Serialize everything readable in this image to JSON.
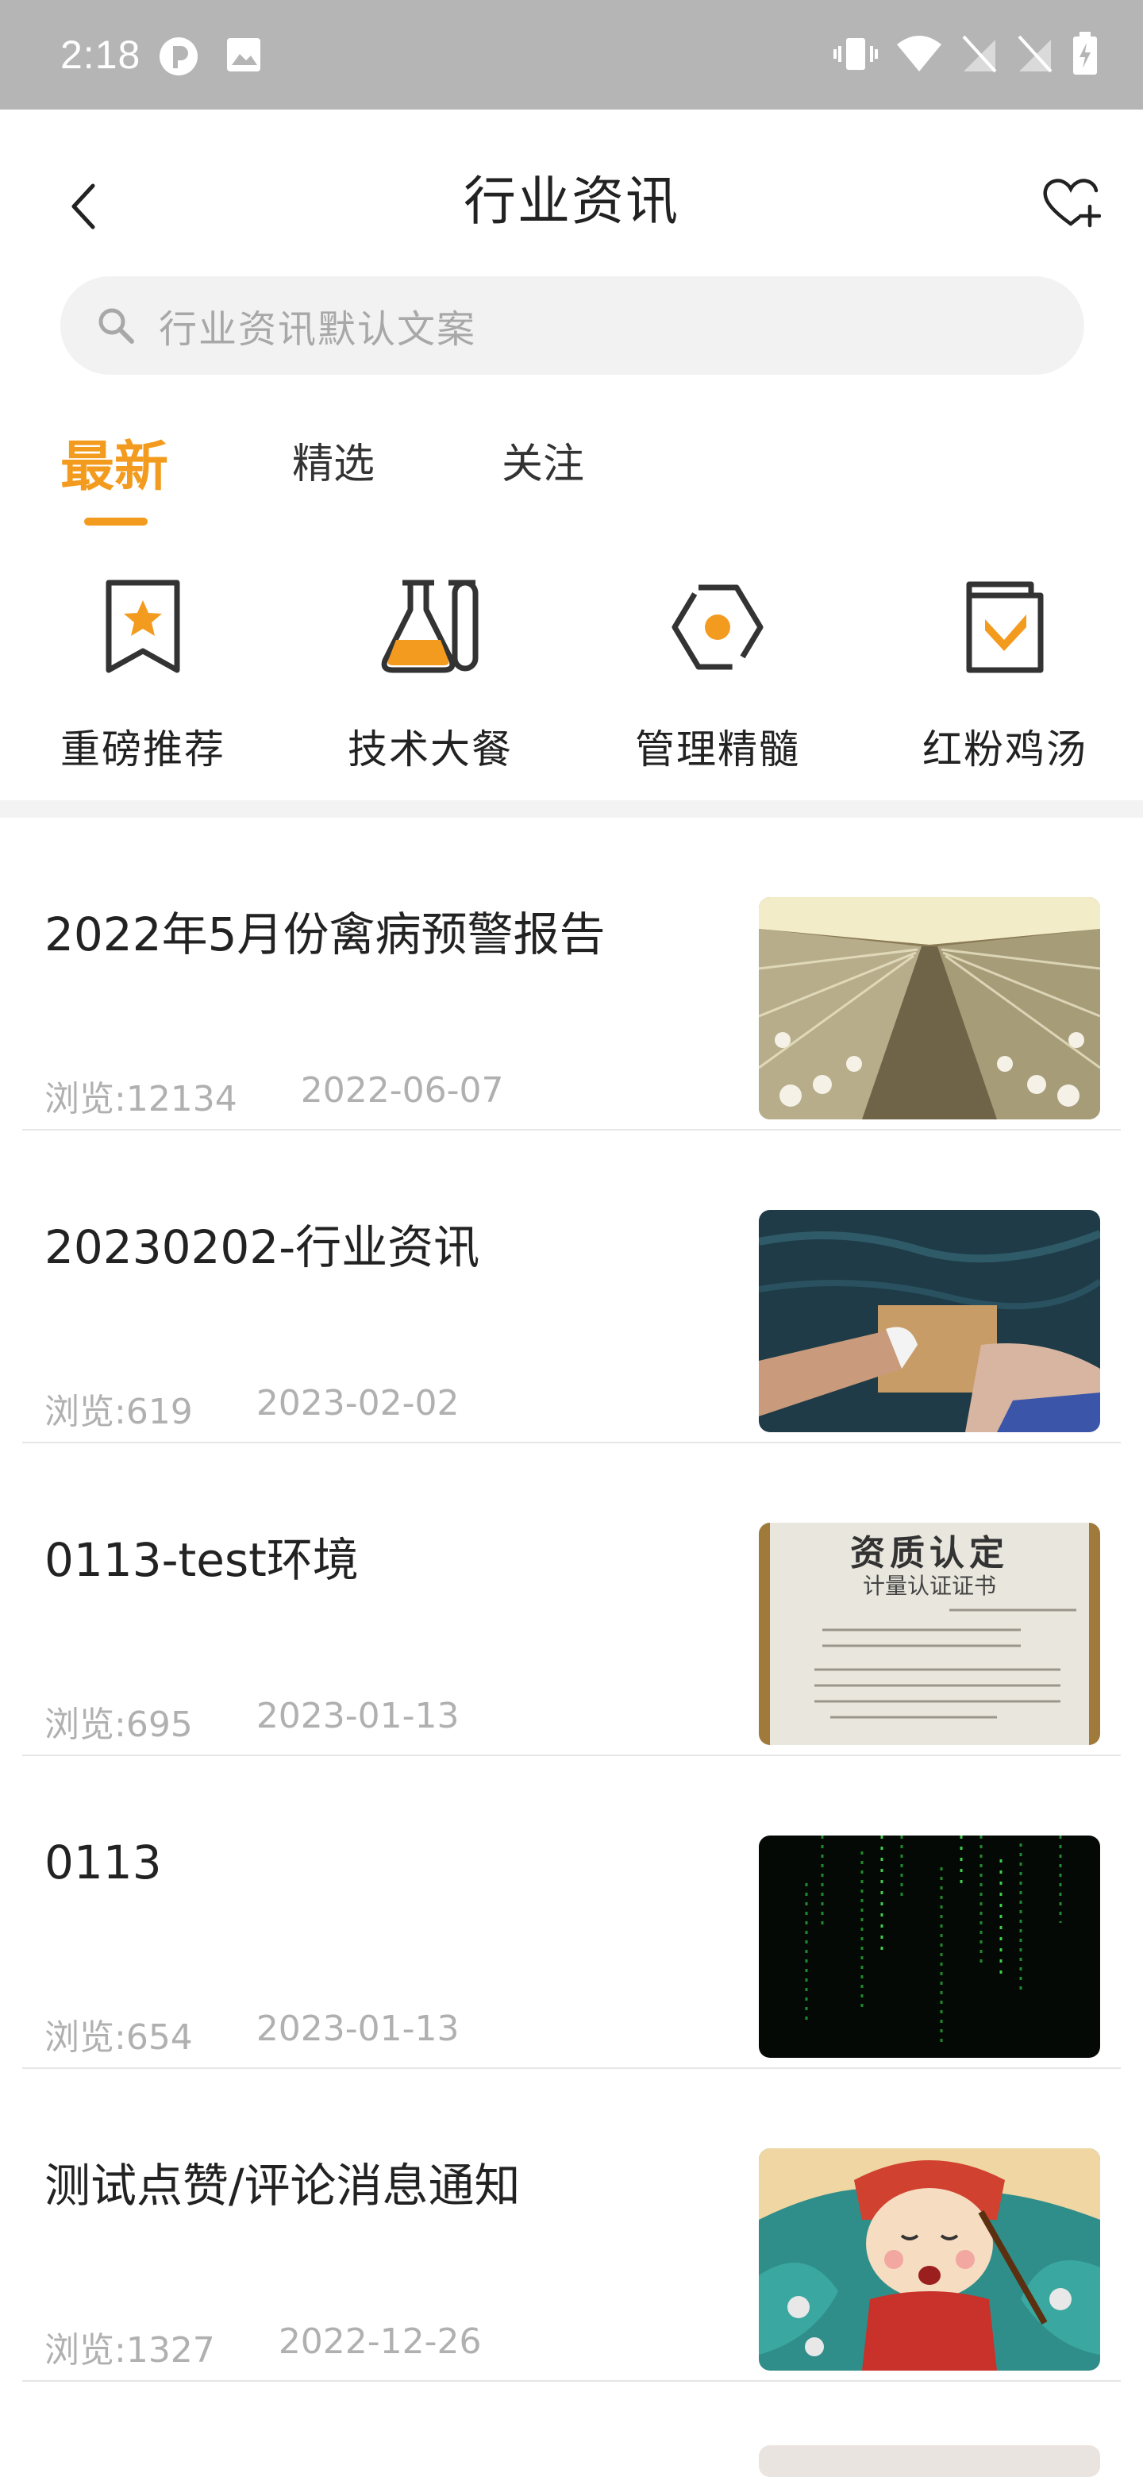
{
  "status_bar": {
    "time": "2:18",
    "left_icons": [
      "pinwheel-app-icon",
      "image-icon"
    ],
    "right_icons": [
      "vibrate-icon",
      "wifi-icon",
      "no-sim-icon",
      "no-sim-icon",
      "battery-charging-icon"
    ]
  },
  "header": {
    "title": "行业资讯",
    "back_icon": "chevron-left-icon",
    "favorite_icon": "heart-plus-icon"
  },
  "search": {
    "placeholder": "行业资讯默认文案",
    "icon": "search-icon"
  },
  "tabs": [
    {
      "label": "最新",
      "active": true
    },
    {
      "label": "精选",
      "active": false
    },
    {
      "label": "关注",
      "active": false
    }
  ],
  "categories": [
    {
      "label": "重磅推荐",
      "icon": "bookmark-star-icon"
    },
    {
      "label": "技术大餐",
      "icon": "flask-icon"
    },
    {
      "label": "管理精髓",
      "icon": "hexagon-dot-icon"
    },
    {
      "label": "红粉鸡汤",
      "icon": "book-check-icon"
    }
  ],
  "articles": [
    {
      "title": "2022年5月份禽病预警报告",
      "views": "浏览:12134",
      "date": "2022-06-07",
      "thumb": "poultry-farm-image"
    },
    {
      "title": "20230202-行业资讯",
      "views": "浏览:619",
      "date": "2023-02-02",
      "thumb": "sea-legs-image"
    },
    {
      "title": "0113-test环境",
      "views": "浏览:695",
      "date": "2023-01-13",
      "thumb": "certificate-image",
      "thumb_text": {
        "heading": "资质认定",
        "sub": "计量认证证书"
      }
    },
    {
      "title": "0113",
      "views": "浏览:654",
      "date": "2023-01-13",
      "thumb": "matrix-code-image"
    },
    {
      "title": "测试点赞/评论消息通知",
      "views": "浏览:1327",
      "date": "2022-12-26",
      "thumb": "cartoon-character-image"
    }
  ],
  "colors": {
    "accent": "#f39b1e",
    "status_bar": "#b5b5b5",
    "meta_text": "#b0b0b0"
  }
}
